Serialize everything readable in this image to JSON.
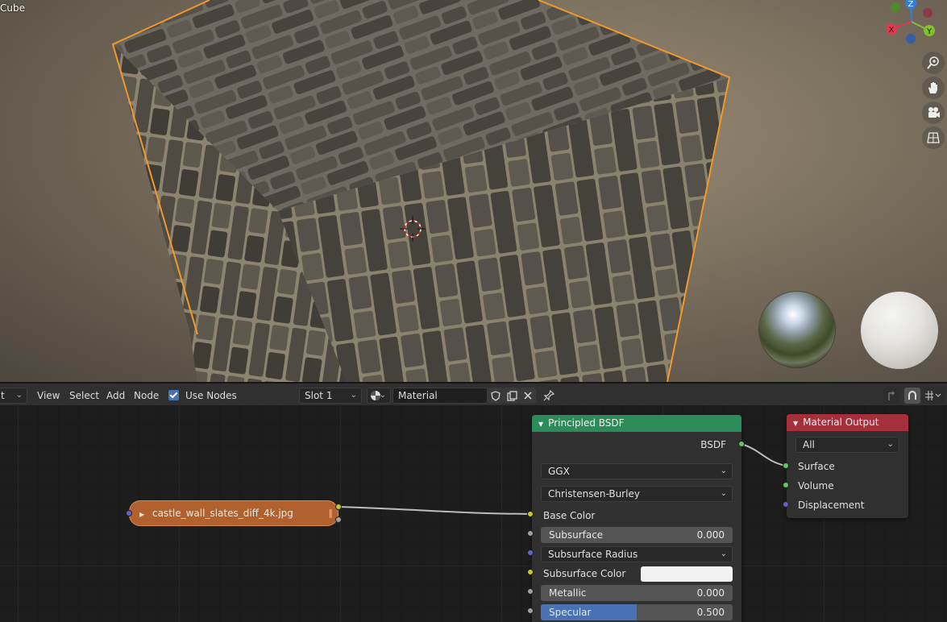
{
  "viewport": {
    "object_name": "Cube"
  },
  "gizmo": {
    "x_label": "X",
    "y_label": "Y",
    "z_label": "Z"
  },
  "header": {
    "editor_selector": "t",
    "menu": [
      "View",
      "Select",
      "Add",
      "Node"
    ],
    "use_nodes_label": "Use Nodes",
    "use_nodes_checked": true,
    "slot": "Slot 1",
    "material_name": "Material"
  },
  "nodes": {
    "image": {
      "label": "castle_wall_slates_diff_4k.jpg",
      "color": "#b0612e"
    },
    "principled": {
      "title": "Principled BSDF",
      "header_color": "#2b8c5a",
      "output": "BSDF",
      "distribution": "GGX",
      "subsurface_method": "Christensen-Burley",
      "base_color_label": "Base Color",
      "subsurface": {
        "label": "Subsurface",
        "value": "0.000",
        "fraction": 0
      },
      "subsurface_radius": "Subsurface Radius",
      "subsurface_color": "Subsurface Color",
      "metallic": {
        "label": "Metallic",
        "value": "0.000",
        "fraction": 0
      },
      "specular": {
        "label": "Specular",
        "value": "0.500",
        "fraction": 0.5
      }
    },
    "output": {
      "title": "Material Output",
      "header_color": "#a3303a",
      "target": "All",
      "inputs": [
        "Surface",
        "Volume",
        "Displacement"
      ]
    }
  }
}
